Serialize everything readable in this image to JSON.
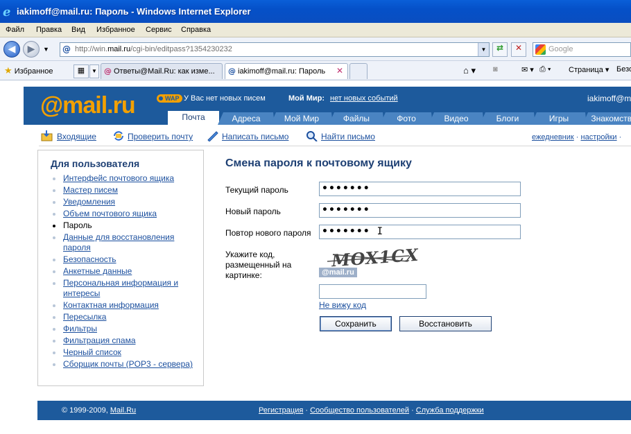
{
  "window": {
    "title": "iakimoff@mail.ru: Пароль - Windows Internet Explorer"
  },
  "menu": [
    "Файл",
    "Правка",
    "Вид",
    "Избранное",
    "Сервис",
    "Справка"
  ],
  "address": {
    "prefix": "http://win.",
    "domain": "mail.ru",
    "path": "/cgi-bin/editpass?1354230232",
    "search_placeholder": "Google"
  },
  "tabs": {
    "favorites_label": "Избранное",
    "items": [
      {
        "label": "Ответы@Mail.Ru: как изме...",
        "active": false
      },
      {
        "label": "iakimoff@mail.ru: Пароль",
        "active": true
      }
    ],
    "page_menu": "Страница",
    "safety_menu": "Безо"
  },
  "header": {
    "logo": "@mail.ru",
    "wap": "WAP",
    "no_mail": "У Вас нет новых писем",
    "mymir_label": "Мой Мир:",
    "mymir_events": "нет новых событий",
    "user": "iakimoff@mail.ru",
    "nav_tabs": [
      "Почта",
      "Адреса",
      "Мой Мир",
      "Файлы",
      "Фото",
      "Видео",
      "Блоги",
      "Игры",
      "Знакомства"
    ]
  },
  "subnav": {
    "inbox": "Входящие",
    "check": "Проверить почту",
    "compose": "Написать письмо",
    "find": "Найти письмо",
    "diary": "ежедневник",
    "settings": "настройки"
  },
  "sidebar": {
    "title": "Для пользователя",
    "items": [
      "Интерфейс почтового ящика",
      "Мастер писем",
      "Уведомления",
      "Объем почтового ящика",
      "Пароль",
      "Данные для восстановления пароля",
      "Безопасность",
      "Анкетные данные",
      "Персональная информация и интересы",
      "Контактная информация",
      "Пересылка",
      "Фильтры",
      "Фильтрация спама",
      "Черный список",
      "Сборщик почты (POP3 - сервера)"
    ],
    "current_index": 4
  },
  "form": {
    "title": "Смена пароля к почтовому ящику",
    "current_label": "Текущий пароль",
    "current_value": "•••••••",
    "new_label": "Новый пароль",
    "new_value": "•••••••",
    "repeat_label": "Повтор нового пароля",
    "repeat_value": "•••••••",
    "code_label": "Укажите код, размещенный на картинке:",
    "captcha_text": "MOX1CX",
    "captcha_logo": "@mail.ru",
    "code_value": "",
    "cant_see": "Не вижу код",
    "save": "Сохранить",
    "restore": "Восстановить"
  },
  "footer": {
    "copyright": "© 1999-2009, ",
    "copyright_link": "Mail.Ru",
    "links": [
      "Регистрация",
      "Сообщество пользователей",
      "Служба поддержки"
    ]
  }
}
